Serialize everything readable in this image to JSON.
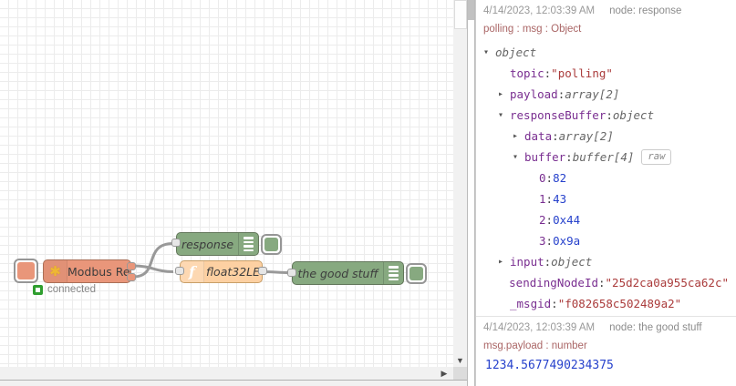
{
  "canvas": {
    "nodes": {
      "modbus": {
        "label": "Modbus Read",
        "status": "connected",
        "color": "#e9967a",
        "icon": "asterisk-icon"
      },
      "response": {
        "label": "response",
        "color": "#87a980",
        "icon": "debug-list-icon"
      },
      "converter": {
        "label": "float32LE",
        "color": "#fdd0a2",
        "icon": "function-icon",
        "icon_glyph": "f"
      },
      "good_stuff": {
        "label": "the good stuff",
        "color": "#87a980",
        "icon": "debug-list-icon"
      }
    },
    "wire_color": "#999999"
  },
  "debug_sidebar": {
    "messages": [
      {
        "timestamp": "4/14/2023, 12:03:39 AM",
        "node": "node: response",
        "subject": "polling : msg : Object",
        "tree": [
          {
            "key": "",
            "value": "object"
          },
          {
            "key": "topic",
            "value": "\"polling\""
          },
          {
            "key": "payload",
            "value": "array[2]"
          },
          {
            "key": "responseBuffer",
            "value": "object"
          },
          {
            "key": "data",
            "value": "array[2]"
          },
          {
            "key": "buffer",
            "value": "buffer[4]",
            "badge": "raw"
          },
          {
            "key": "0",
            "value": "82"
          },
          {
            "key": "1",
            "value": "43"
          },
          {
            "key": "2",
            "value": "0x44"
          },
          {
            "key": "3",
            "value": "0x9a"
          },
          {
            "key": "input",
            "value": "object"
          },
          {
            "key": "sendingNodeId",
            "value": "\"25d2ca0a955ca62c\""
          },
          {
            "key": "_msgid",
            "value": "\"f082658c502489a2\""
          }
        ]
      },
      {
        "timestamp": "4/14/2023, 12:03:39 AM",
        "node": "node: the good stuff",
        "subject": "msg.payload : number",
        "value": "1234.5677490234375"
      }
    ],
    "colors": {
      "key": "#792e90",
      "string": "#aa3b3b",
      "number": "#2742cc",
      "type": "#666666",
      "subject": "#aa6666"
    }
  }
}
